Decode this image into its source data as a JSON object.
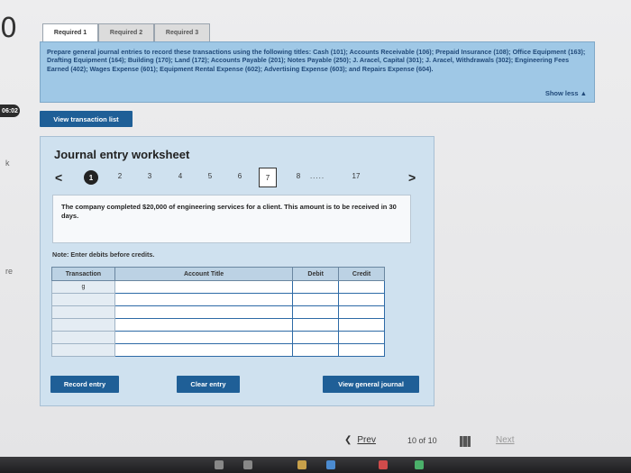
{
  "left_margin": {
    "big_glyph": "0",
    "timer": "06:02",
    "mark1": "k",
    "mark2": "re"
  },
  "tabs": [
    {
      "label": "Required 1"
    },
    {
      "label": "Required 2"
    },
    {
      "label": "Required 3"
    }
  ],
  "instructions": {
    "text": "Prepare general journal entries to record these transactions using the following titles: Cash (101); Accounts Receivable (106); Prepaid Insurance (108); Office Equipment (163); Drafting Equipment (164); Building (170); Land (172); Accounts Payable (201); Notes Payable (250); J. Aracel, Capital (301); J. Aracel, Withdrawals (302); Engineering Fees Earned (402); Wages Expense (601); Equipment Rental Expense (602); Advertising Expense (603); and Repairs Expense (604).",
    "show_less": "Show less ▲"
  },
  "view_transaction_list": "View transaction list",
  "worksheet": {
    "title": "Journal entry worksheet",
    "pager": {
      "prev_arrow": "<",
      "next_arrow": ">",
      "current": "1",
      "pages": [
        "2",
        "3",
        "4",
        "5",
        "6"
      ],
      "boxed": "7",
      "after_box": "8",
      "ellipsis": ".....",
      "last": "17"
    },
    "description": "The company completed $20,000 of engineering services for a client. This amount is to be received in 30 days.",
    "note": "Note: Enter debits before credits.",
    "table": {
      "headers": [
        "Transaction",
        "Account Title",
        "Debit",
        "Credit"
      ],
      "rows": [
        [
          "g",
          "",
          "",
          ""
        ],
        [
          "",
          "",
          "",
          ""
        ],
        [
          "",
          "",
          "",
          ""
        ],
        [
          "",
          "",
          "",
          ""
        ],
        [
          "",
          "",
          "",
          ""
        ],
        [
          "",
          "",
          "",
          ""
        ]
      ]
    },
    "buttons": {
      "record": "Record entry",
      "clear": "Clear entry",
      "view_journal": "View general journal"
    }
  },
  "bottom_nav": {
    "prev": "Prev",
    "page_current": "10",
    "page_of": "of",
    "page_total": "10",
    "next": "Next"
  },
  "colors": {
    "accent_blue": "#1f5f97",
    "instruction_bg": "#9fc8e6",
    "panel_bg": "#cfe1ef"
  }
}
